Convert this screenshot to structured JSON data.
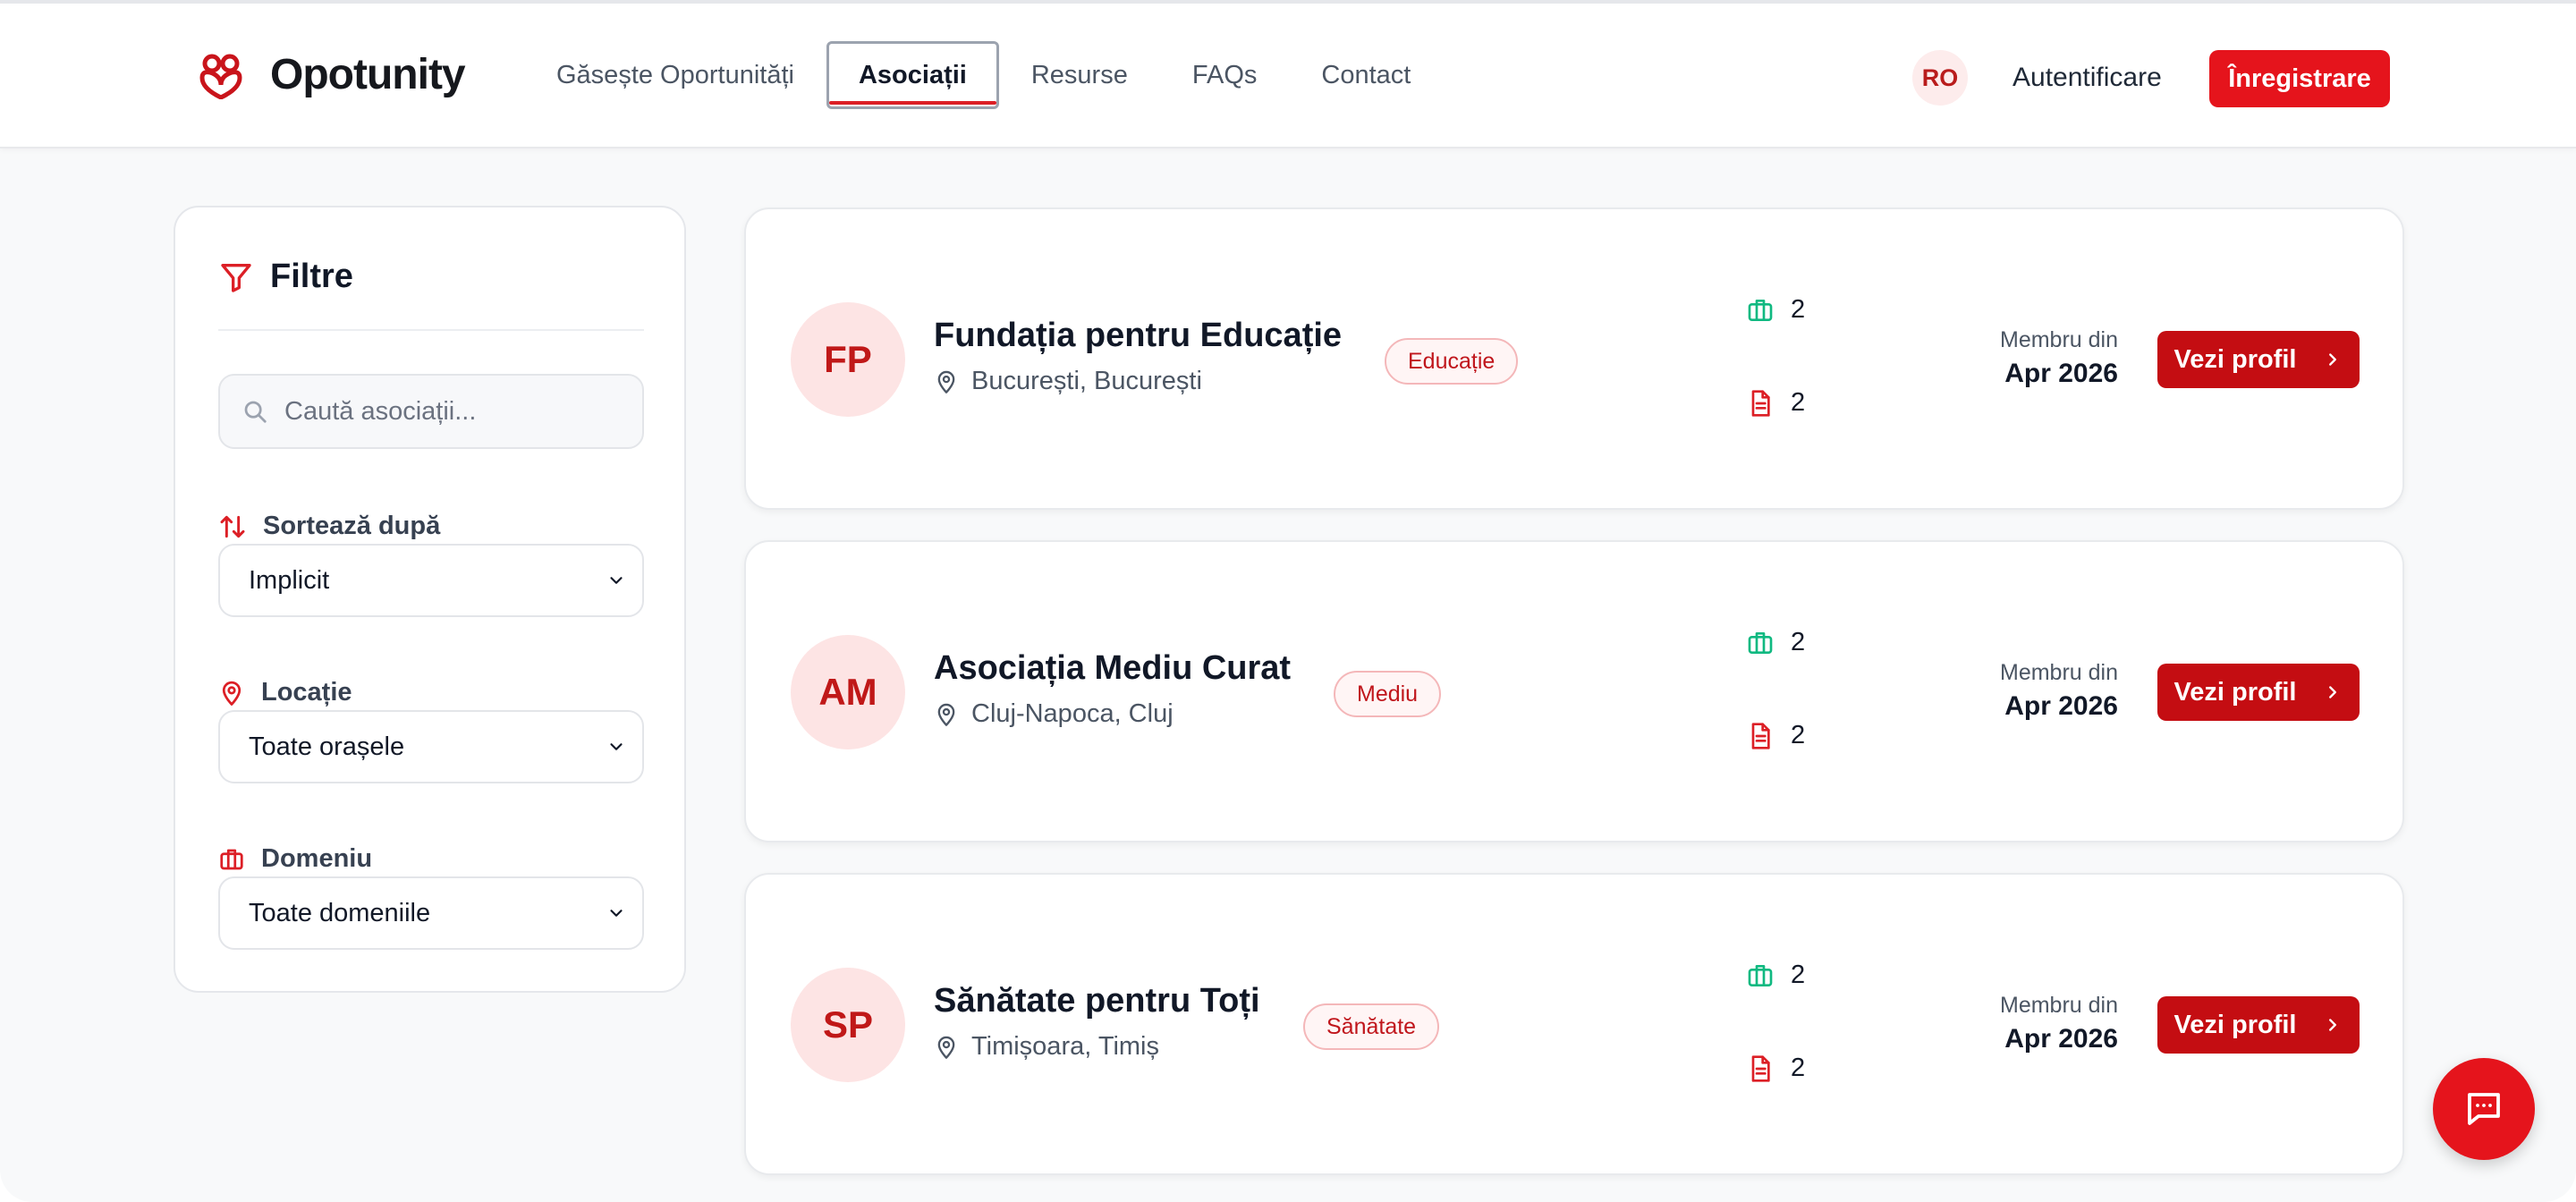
{
  "brand": {
    "name": "Opotunity",
    "accent": "#e5141c",
    "dark_accent": "#c40d12"
  },
  "nav": {
    "items": [
      "Găsește Oportunități",
      "Asociații",
      "Resurse",
      "FAQs",
      "Contact"
    ],
    "active": "Asociații"
  },
  "header": {
    "lang": "RO",
    "login": "Autentificare",
    "register": "Înregistrare"
  },
  "filters": {
    "title": "Filtre",
    "search_placeholder": "Caută asociații...",
    "sort_label": "Sortează după",
    "sort_value": "Implicit",
    "location_label": "Locație",
    "location_value": "Toate orașele",
    "domain_label": "Domeniu",
    "domain_value": "Toate domeniile"
  },
  "organizations": [
    {
      "initials": "FP",
      "name": "Fundația pentru Educație",
      "location": "București, București",
      "tag": "Educație",
      "opportunities": "2",
      "resources": "2",
      "member_label": "Membru din",
      "member_since": "Apr 2026",
      "button": "Vezi profil"
    },
    {
      "initials": "AM",
      "name": "Asociația Mediu Curat",
      "location": "Cluj-Napoca, Cluj",
      "tag": "Mediu",
      "opportunities": "2",
      "resources": "2",
      "member_label": "Membru din",
      "member_since": "Apr 2026",
      "button": "Vezi profil"
    },
    {
      "initials": "SP",
      "name": "Sănătate pentru Toți",
      "location": "Timișoara, Timiș",
      "tag": "Sănătate",
      "opportunities": "2",
      "resources": "2",
      "member_label": "Membru din",
      "member_since": "Apr 2026",
      "button": "Vezi profil"
    }
  ],
  "icons": {
    "filter": "filter-icon",
    "search": "search-icon",
    "sort": "sort-arrows-icon",
    "location": "map-pin-icon",
    "domain": "briefcase-icon",
    "resources": "document-icon",
    "chevron": "chevron-down-icon",
    "chat": "chat-icon"
  }
}
